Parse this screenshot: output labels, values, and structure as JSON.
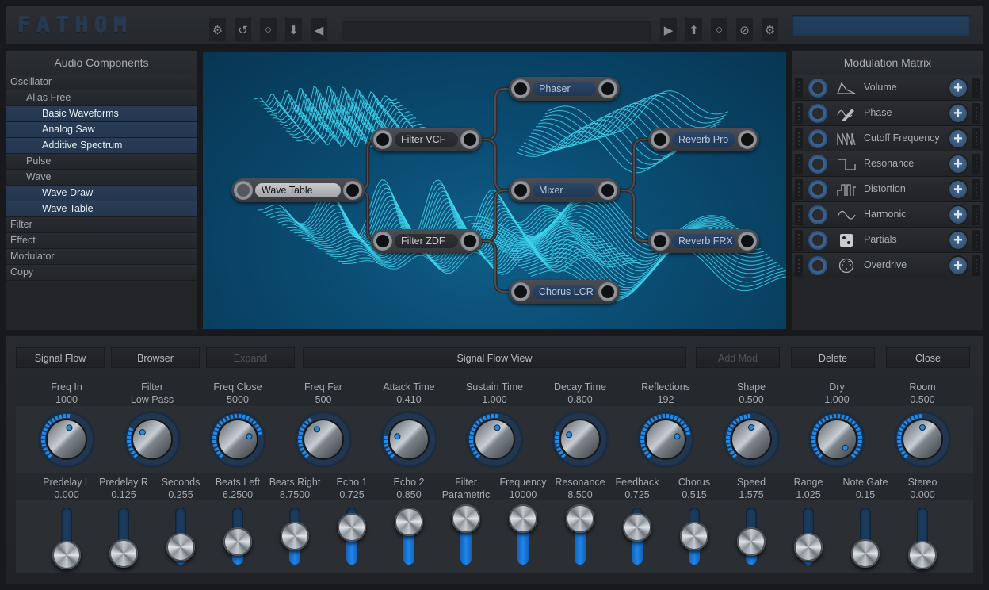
{
  "app": {
    "logo_letters": [
      "F",
      "A",
      "T",
      "H",
      "O",
      "M"
    ]
  },
  "toolbar": {
    "left_buttons": [
      {
        "name": "settings-button",
        "icon": "gear-icon",
        "glyph": "⚙"
      },
      {
        "name": "undo-button",
        "icon": "undo-icon",
        "glyph": "↺"
      },
      {
        "name": "record-button",
        "icon": "circle-icon",
        "glyph": "○"
      },
      {
        "name": "download-button",
        "icon": "arrow-down-icon",
        "glyph": "⬇"
      },
      {
        "name": "back-button",
        "icon": "triangle-left-icon",
        "glyph": "◀"
      }
    ],
    "right_buttons": [
      {
        "name": "play-button",
        "icon": "triangle-right-icon",
        "glyph": "▶"
      },
      {
        "name": "upload-button",
        "icon": "arrow-up-icon",
        "glyph": "⬆"
      },
      {
        "name": "circle-button",
        "icon": "circle-icon",
        "glyph": "○"
      },
      {
        "name": "clear-button",
        "icon": "no-entry-icon",
        "glyph": "⊘"
      },
      {
        "name": "preferences-button",
        "icon": "gear-icon",
        "glyph": "⚙"
      }
    ],
    "preset_field": "",
    "level_field": ""
  },
  "audio_components": {
    "title": "Audio Components",
    "items": [
      {
        "label": "Oscillator",
        "level": 0,
        "selected": false
      },
      {
        "label": "Alias Free",
        "level": 1,
        "selected": false
      },
      {
        "label": "Basic Waveforms",
        "level": 2,
        "selected": true
      },
      {
        "label": "Analog Saw",
        "level": 2,
        "selected": true
      },
      {
        "label": "Additive Spectrum",
        "level": 2,
        "selected": true
      },
      {
        "label": "Pulse",
        "level": 1,
        "selected": false
      },
      {
        "label": "Wave",
        "level": 1,
        "selected": false
      },
      {
        "label": "Wave Draw",
        "level": 2,
        "selected": true
      },
      {
        "label": "Wave Table",
        "level": 2,
        "selected": true
      },
      {
        "label": "Filter",
        "level": 0,
        "selected": false
      },
      {
        "label": "Effect",
        "level": 0,
        "selected": false
      },
      {
        "label": "Modulator",
        "level": 0,
        "selected": false
      },
      {
        "label": "Copy",
        "level": 0,
        "selected": false
      }
    ]
  },
  "modulation_matrix": {
    "title": "Modulation Matrix",
    "rows": [
      {
        "label": "Volume",
        "icon": "envelope-icon"
      },
      {
        "label": "Phase",
        "icon": "pencil-wave-icon"
      },
      {
        "label": "Cutoff Frequency",
        "icon": "sawtooth-icon"
      },
      {
        "label": "Resonance",
        "icon": "square-wave-icon"
      },
      {
        "label": "Distortion",
        "icon": "pulse-wave-icon"
      },
      {
        "label": "Harmonic",
        "icon": "sine-wave-icon"
      },
      {
        "label": "Partials",
        "icon": "dice-icon"
      },
      {
        "label": "Overdrive",
        "icon": "midi-connector-icon"
      }
    ],
    "add_glyph": "+"
  },
  "signal_flow": {
    "nodes": [
      {
        "id": "wavetable",
        "label": "Wave Table",
        "style": "light"
      },
      {
        "id": "vcf",
        "label": "Filter VCF",
        "style": "dark"
      },
      {
        "id": "zdf",
        "label": "Filter ZDF",
        "style": "dark"
      },
      {
        "id": "phaser",
        "label": "Phaser",
        "style": "blue"
      },
      {
        "id": "mixer",
        "label": "Mixer",
        "style": "blue"
      },
      {
        "id": "chorus",
        "label": "Chorus LCR",
        "style": "blue"
      },
      {
        "id": "revpro",
        "label": "Reverb Pro",
        "style": "blue"
      },
      {
        "id": "revfrx",
        "label": "Reverb FRX",
        "style": "blue"
      }
    ],
    "connections": [
      [
        "wavetable",
        "vcf"
      ],
      [
        "wavetable",
        "zdf"
      ],
      [
        "vcf",
        "phaser"
      ],
      [
        "vcf",
        "mixer"
      ],
      [
        "zdf",
        "mixer"
      ],
      [
        "zdf",
        "chorus"
      ],
      [
        "mixer",
        "revpro"
      ],
      [
        "mixer",
        "revfrx"
      ]
    ]
  },
  "bottom_bar": {
    "signal_flow": "Signal Flow",
    "browser": "Browser",
    "expand": "Expand",
    "view_title": "Signal Flow View",
    "add_mod": "Add Mod",
    "delete": "Delete",
    "close": "Close"
  },
  "knobs": [
    {
      "label": "Freq In",
      "value": "1000",
      "position": 0.55
    },
    {
      "label": "Filter",
      "value": "Low Pass",
      "position": 0.3
    },
    {
      "label": "Freq Close",
      "value": "5000",
      "position": 0.78
    },
    {
      "label": "Freq Far",
      "value": "500",
      "position": 0.38
    },
    {
      "label": "Attack Time",
      "value": "0.410",
      "position": 0.22
    },
    {
      "label": "Sustain Time",
      "value": "1.000",
      "position": 0.55
    },
    {
      "label": "Decay Time",
      "value": "0.800",
      "position": 0.25
    },
    {
      "label": "Reflections",
      "value": "192",
      "position": 0.78
    },
    {
      "label": "Shape",
      "value": "0.500",
      "position": 0.5
    },
    {
      "label": "Dry",
      "value": "1.000",
      "position": 1.0
    },
    {
      "label": "Room",
      "value": "0.500",
      "position": 0.5
    }
  ],
  "sliders": [
    {
      "label": "Predelay L",
      "value": "0.000",
      "position": 0.1
    },
    {
      "label": "Predelay R",
      "value": "0.125",
      "position": 0.2
    },
    {
      "label": "Seconds",
      "value": "0.255",
      "position": 0.3
    },
    {
      "label": "Beats Left",
      "value": "6.2500",
      "position": 0.4
    },
    {
      "label": "Beats Right",
      "value": "8.7500",
      "position": 0.5
    },
    {
      "label": "Echo 1",
      "value": "0.725",
      "position": 0.65
    },
    {
      "label": "Echo 2",
      "value": "0.850",
      "position": 0.75
    },
    {
      "label": "Filter",
      "value": "Parametric",
      "position": 0.9
    },
    {
      "label": "Frequency",
      "value": "10000",
      "position": 0.9
    },
    {
      "label": "Resonance",
      "value": "8.500",
      "position": 0.8
    },
    {
      "label": "Feedback",
      "value": "0.725",
      "position": 0.65
    },
    {
      "label": "Chorus",
      "value": "0.515",
      "position": 0.5
    },
    {
      "label": "Speed",
      "value": "1.575",
      "position": 0.4
    },
    {
      "label": "Range",
      "value": "1.025",
      "position": 0.3
    },
    {
      "label": "Note Gate",
      "value": "0.15",
      "position": 0.2
    },
    {
      "label": "Stereo",
      "value": "0.000",
      "position": 0.1
    }
  ],
  "colors": {
    "accent": "#1f86e8",
    "wave": "#3fd6f0",
    "selected_item": "#2a3d55"
  }
}
